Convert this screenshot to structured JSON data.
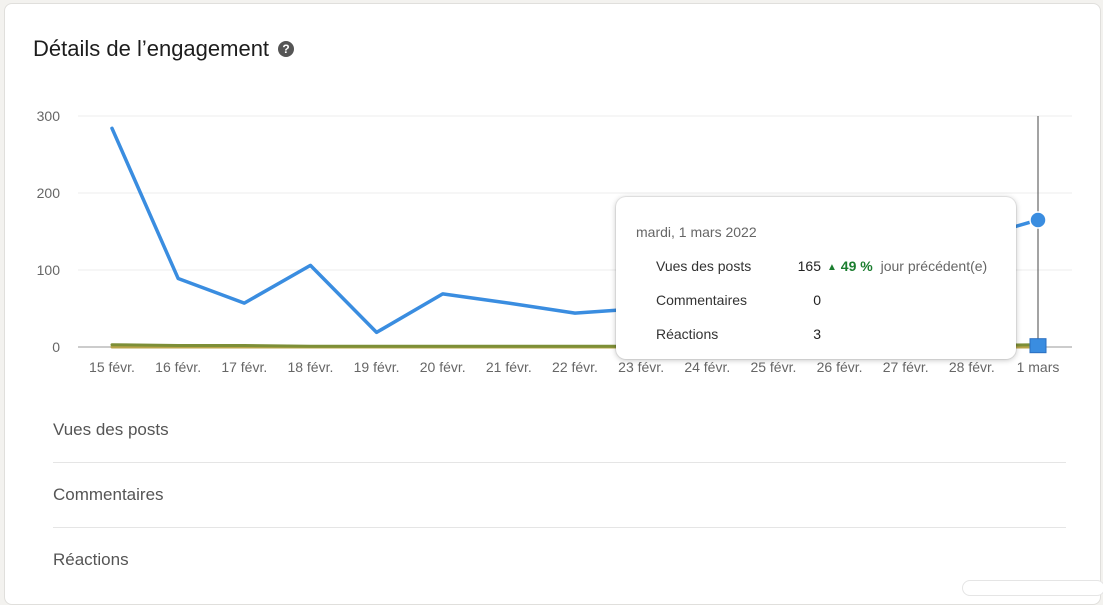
{
  "card": {
    "title": "Détails de l’engagement",
    "help_glyph": "?"
  },
  "tooltip": {
    "date": "mardi, 1 mars 2022",
    "rows": [
      {
        "label": "Vues des posts",
        "value": "165",
        "change_arrow": "▲",
        "change_pct": "49 %",
        "change_suffix": "jour précédent(e)"
      },
      {
        "label": "Commentaires",
        "value": "0"
      },
      {
        "label": "Réactions",
        "value": "3"
      }
    ]
  },
  "metrics": [
    "Vues des posts",
    "Commentaires",
    "Réactions"
  ],
  "colors": {
    "views": "#3a8de0",
    "reactions": "#7d8f37",
    "comments": "#b9a44a",
    "positive": "#1b7d2f"
  },
  "chart_data": {
    "type": "line",
    "title": "",
    "xlabel": "",
    "ylabel": "",
    "ylim": [
      0,
      300
    ],
    "yticks": [
      0,
      100,
      200,
      300
    ],
    "grid": true,
    "categories": [
      "15 févr.",
      "16 févr.",
      "17 févr.",
      "18 févr.",
      "19 févr.",
      "20 févr.",
      "21 févr.",
      "22 févr.",
      "23 févr.",
      "24 févr.",
      "25 févr.",
      "26 févr.",
      "27 févr.",
      "28 févr.",
      "1 mars"
    ],
    "highlight_index": 14,
    "series": [
      {
        "key": "views",
        "values": [
          284,
          89,
          57,
          106,
          19,
          69,
          57,
          44,
          50,
          80,
          120,
          100,
          90,
          140,
          165
        ]
      },
      {
        "key": "reactions",
        "values": [
          3,
          2,
          2,
          1,
          1,
          1,
          1,
          1,
          1,
          1,
          1,
          1,
          1,
          2,
          3
        ]
      },
      {
        "key": "comments",
        "values": [
          0,
          0,
          0,
          0,
          0,
          0,
          0,
          0,
          0,
          0,
          0,
          0,
          0,
          0,
          0
        ]
      }
    ]
  }
}
